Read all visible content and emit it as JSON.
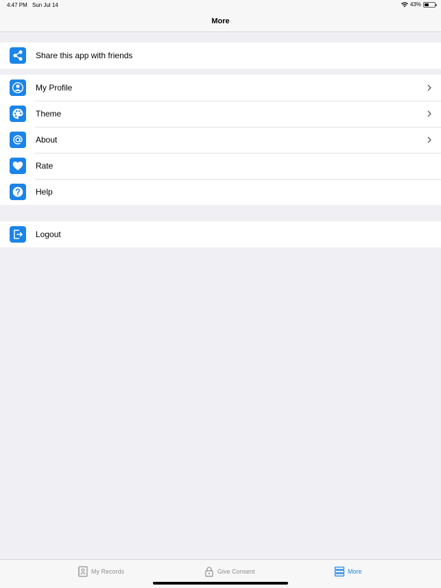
{
  "status_bar": {
    "time": "4:47 PM",
    "date": "Sun Jul 14",
    "battery": "43%",
    "battery_level": 0.43,
    "icons": [
      "wifi-icon",
      "battery-icon"
    ]
  },
  "nav": {
    "title": "More"
  },
  "sections": {
    "share": [
      {
        "label": "Share this app with friends",
        "icon": "share-icon",
        "chevron": false
      }
    ],
    "main": [
      {
        "label": "My Profile",
        "icon": "profile-icon",
        "chevron": true
      },
      {
        "label": "Theme",
        "icon": "palette-icon",
        "chevron": true
      },
      {
        "label": "About",
        "icon": "at-sign-icon",
        "chevron": true
      },
      {
        "label": "Rate",
        "icon": "heart-icon",
        "chevron": false
      },
      {
        "label": "Help",
        "icon": "help-icon",
        "chevron": false
      }
    ],
    "logout": [
      {
        "label": "Logout",
        "icon": "logout-icon",
        "chevron": false
      }
    ]
  },
  "tabs": [
    {
      "label": "My Records",
      "icon": "records-icon",
      "active": false
    },
    {
      "label": "Give Consent",
      "icon": "lock-icon",
      "active": false
    },
    {
      "label": "More",
      "icon": "menu-icon",
      "active": true
    }
  ],
  "colors": {
    "accent": "#1b84e8",
    "background": "#efeff4",
    "inactive_tab": "#8e8e93"
  }
}
